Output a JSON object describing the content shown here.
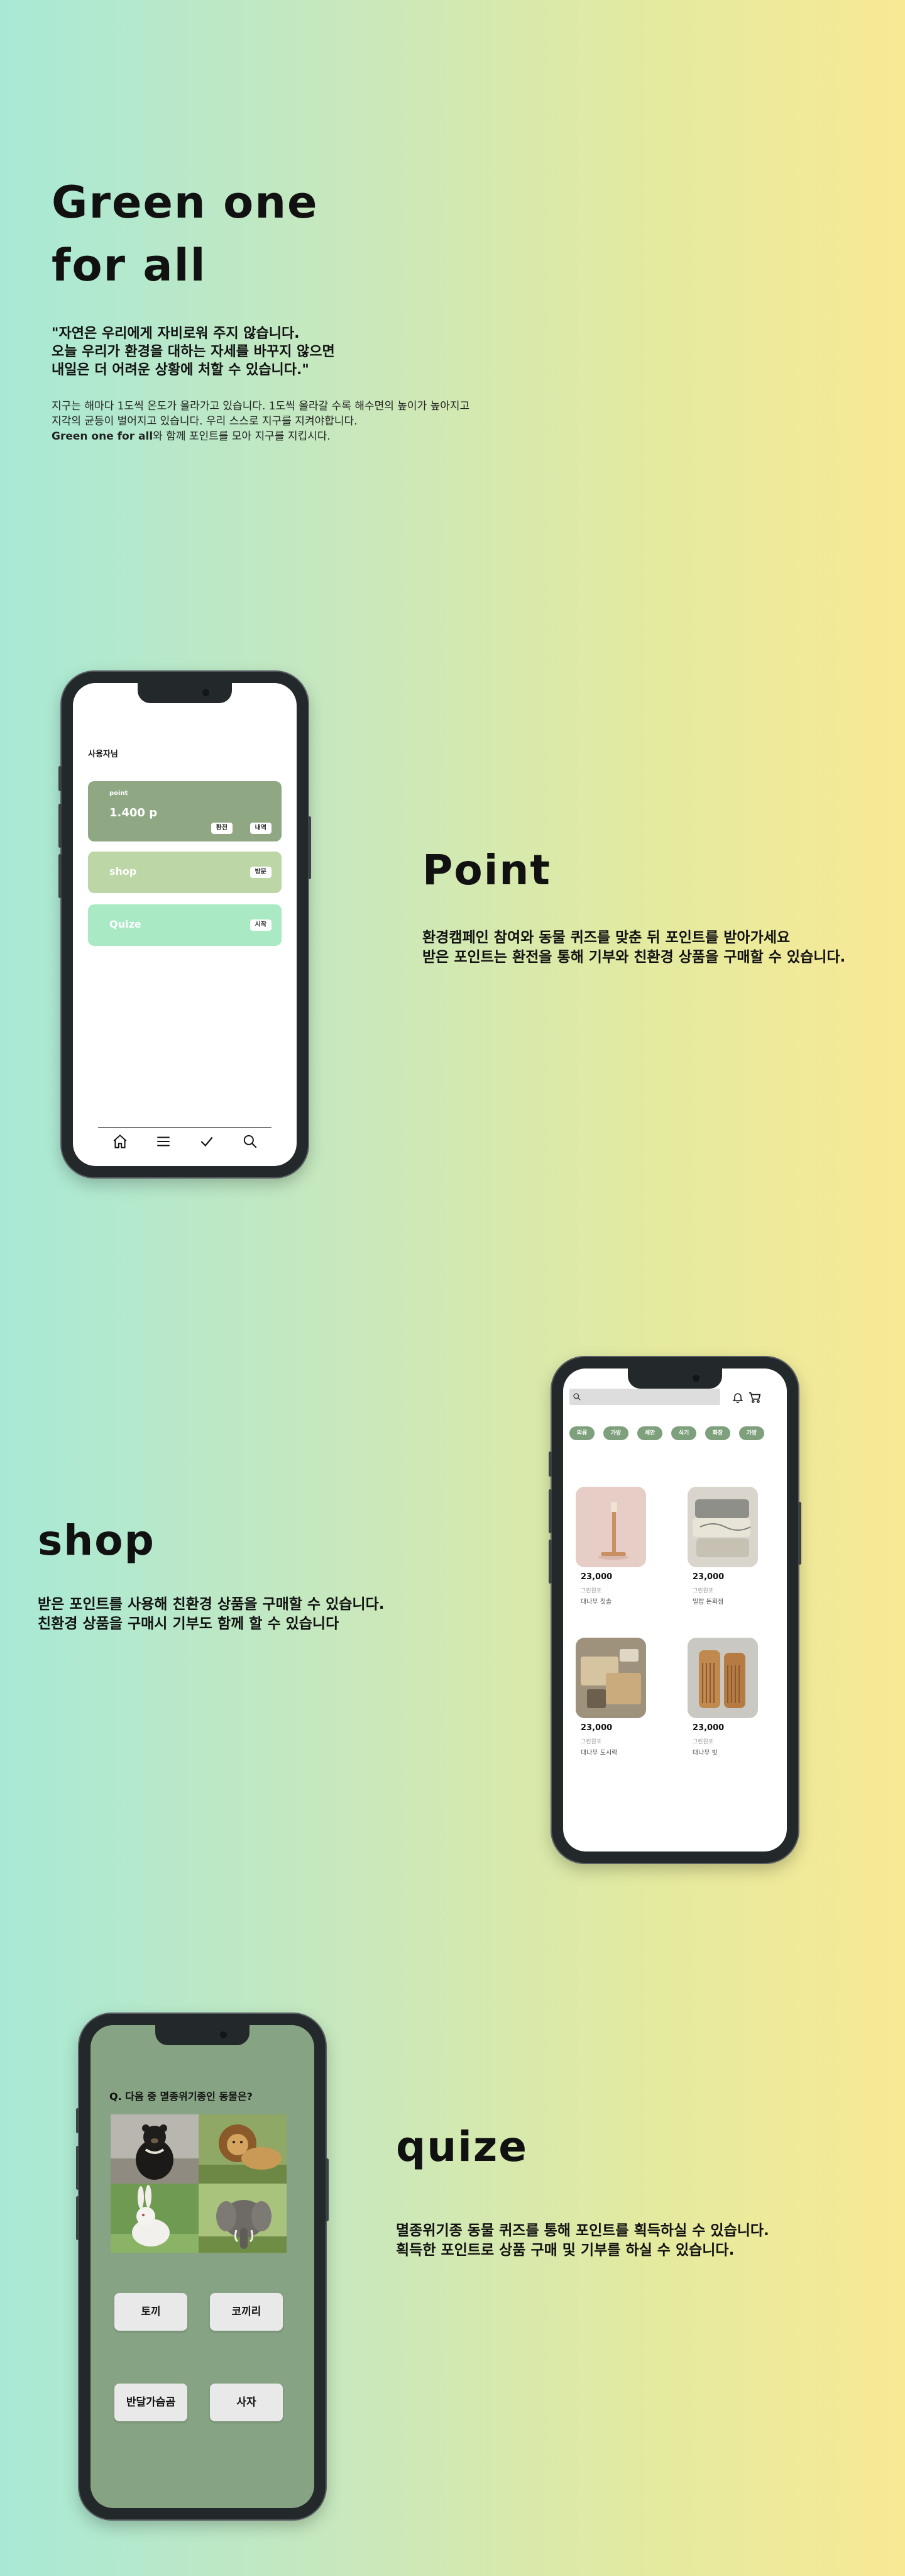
{
  "hero": {
    "title_line1": "Green one",
    "title_line2": "for all",
    "quote_line1": "\"자연은 우리에게 자비로워 주지 않습니다.",
    "quote_line2": "오늘 우리가 환경을 대하는 자세를 바꾸지 않으면",
    "quote_line3": "내일은 더 어려운 상황에 처할 수 있습니다.\"",
    "desc_line1": "지구는 해마다 1도씩 온도가 올라가고 있습니다. 1도씩 올라갈 수록 해수면의 높이가 높아지고",
    "desc_line2": "지각의 균등이 벌어지고 있습니다. 우리 스스로 지구를 지켜야합니다.",
    "desc_line3_bold": "Green one for all",
    "desc_line3_rest": "와 함께 포인트를 모아 지구를 지킵시다."
  },
  "point_section": {
    "title": "Point",
    "line1": "환경캠페인 참여와 동물 퀴즈를 맞춘 뒤 포인트를 받아가세요",
    "line2": "받은 포인트는 환전을 통해 기부와 친환경 상품을 구매할 수 있습니다."
  },
  "shop_section": {
    "title": "shop",
    "line1": "받은 포인트를 사용해 친환경 상품을 구매할 수 있습니다.",
    "line2": "친환경 상품을 구매시 기부도 함께 할 수 있습니다"
  },
  "quize_section": {
    "title": "quize",
    "line1": "멸종위기종 동물  퀴즈를 통해 포인트를 획득하실 수 있습니다.",
    "line2": "획득한 포인트로 상품 구매 및 기부를 하실 수 있습니다."
  },
  "phone_point": {
    "user": "사용자님",
    "point_label": "point",
    "point_value": "1.400 p",
    "btn_exchange": "환전",
    "btn_history": "내역",
    "shop_label": "shop",
    "shop_btn": "방문",
    "quize_label": "Quize",
    "quize_btn": "시작",
    "tab_icons": [
      "home-icon",
      "menu-icon",
      "check-icon",
      "search-icon"
    ],
    "card_colors": {
      "point": "#8fa883",
      "shop": "#bcd6a6",
      "quize": "#a9e9c4"
    }
  },
  "phone_shop": {
    "categories": [
      "의류",
      "가방",
      "세안",
      "식기",
      "화장",
      "가방"
    ],
    "products": [
      {
        "price": "23,000",
        "sub": "그린원포",
        "name": "대나무 칫솔"
      },
      {
        "price": "23,000",
        "sub": "그린원포",
        "name": "밀랍 돈회점"
      },
      {
        "price": "23,000",
        "sub": "그린원포",
        "name": "대나무 도시락"
      },
      {
        "price": "23,000",
        "sub": "그린원포",
        "name": "대나무 빗"
      }
    ],
    "icons": [
      "search-icon",
      "bell-icon",
      "cart-icon"
    ]
  },
  "phone_quize": {
    "question": "Q. 다음 중 멸종위기종인 동물은?",
    "answers": [
      "토끼",
      "코끼리",
      "반달가슴곰",
      "사자"
    ],
    "images": [
      "bear-image",
      "lion-image",
      "rabbit-image",
      "elephant-image"
    ]
  },
  "colors": {
    "accent_green": "#7ea07c",
    "quiz_bg": "#86a383"
  }
}
